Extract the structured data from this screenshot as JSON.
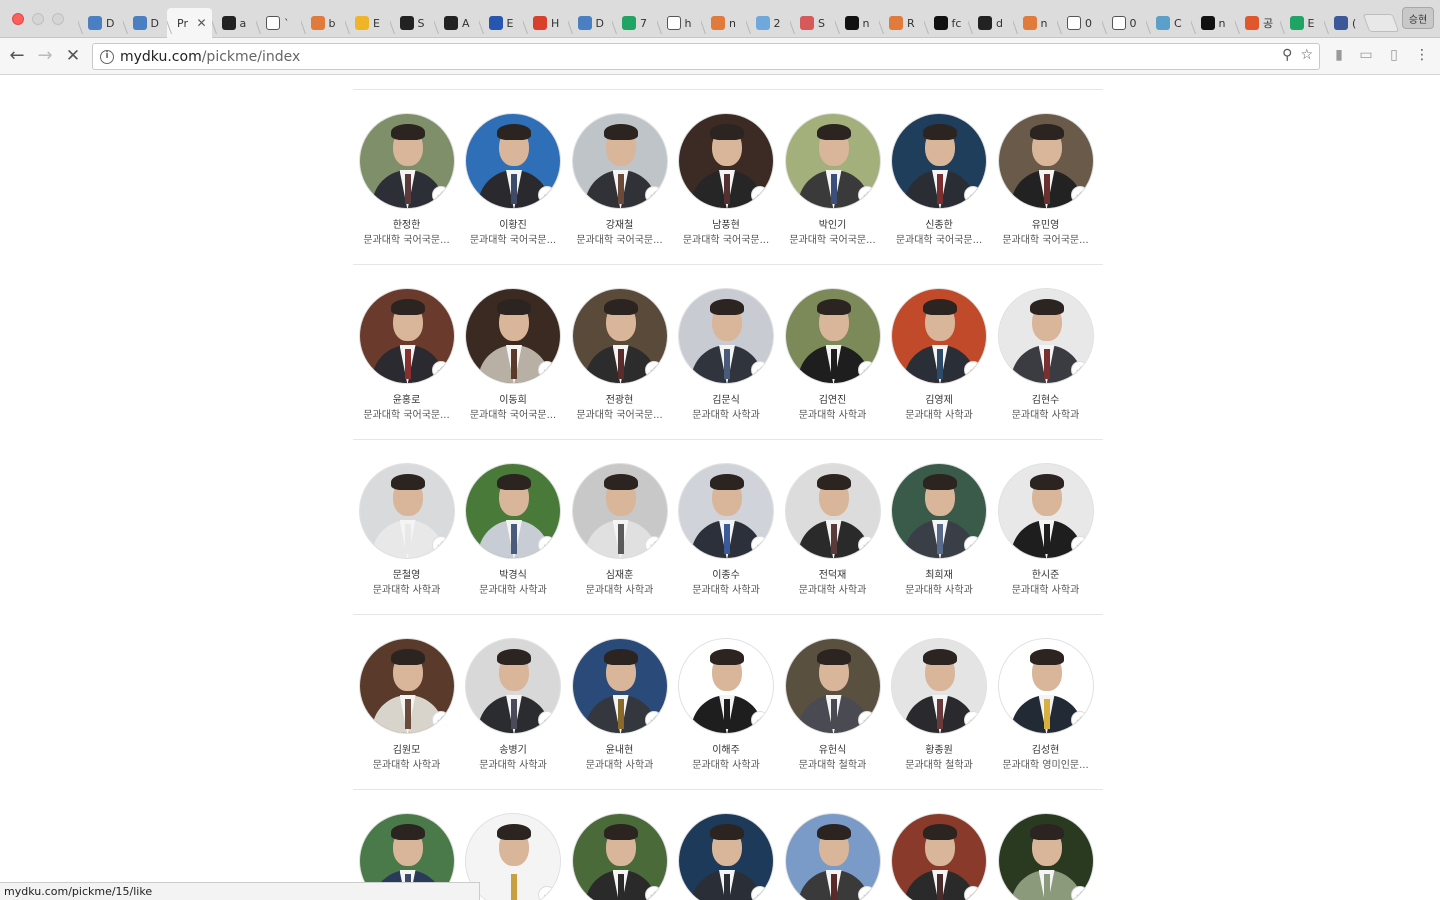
{
  "browser": {
    "tabs": [
      {
        "label": "D",
        "icon": "doc-blue",
        "color": "#4a7fc1"
      },
      {
        "label": "D",
        "icon": "doc-blue",
        "color": "#4a7fc1"
      },
      {
        "label": "Pr",
        "icon": "none",
        "color": "#f6f6f6",
        "active": true
      },
      {
        "label": "a",
        "icon": "github-icon",
        "color": "#222222"
      },
      {
        "label": "`",
        "icon": "page-icon",
        "color": "#ffffff"
      },
      {
        "label": "b",
        "icon": "stack-icon",
        "color": "#e07b3c"
      },
      {
        "label": "E",
        "icon": "box-icon",
        "color": "#f0b429"
      },
      {
        "label": "S",
        "icon": "github-icon",
        "color": "#222222"
      },
      {
        "label": "A",
        "icon": "github-icon",
        "color": "#222222"
      },
      {
        "label": "E",
        "icon": "c-icon",
        "color": "#2656b0"
      },
      {
        "label": "H",
        "icon": "ask-icon",
        "color": "#d9402b"
      },
      {
        "label": "D",
        "icon": "doc-blue",
        "color": "#4a7fc1"
      },
      {
        "label": "7",
        "icon": "drive-icon",
        "color": "#1fa463"
      },
      {
        "label": "h",
        "icon": "page-icon",
        "color": "#ffffff"
      },
      {
        "label": "n",
        "icon": "stack-icon",
        "color": "#e07b3c"
      },
      {
        "label": "2",
        "icon": "star-icon",
        "color": "#6fa8dc"
      },
      {
        "label": "S",
        "icon": "cloud-icon",
        "color": "#d65a5a"
      },
      {
        "label": "n",
        "icon": "k-icon",
        "color": "#111111"
      },
      {
        "label": "R",
        "icon": "stack-icon",
        "color": "#e07b3c"
      },
      {
        "label": "fc",
        "icon": "image-icon",
        "color": "#111111"
      },
      {
        "label": "d",
        "icon": "github-icon",
        "color": "#222222"
      },
      {
        "label": "n",
        "icon": "stack-icon",
        "color": "#e07b3c"
      },
      {
        "label": "0",
        "icon": "google-icon",
        "color": "#ffffff"
      },
      {
        "label": "0",
        "icon": "page-icon",
        "color": "#ffffff"
      },
      {
        "label": "C",
        "icon": "cloud-icon",
        "color": "#5aa0c8"
      },
      {
        "label": "n",
        "icon": "k-icon",
        "color": "#111111"
      },
      {
        "label": "공",
        "icon": "circle-icon",
        "color": "#e0572c"
      },
      {
        "label": "E",
        "icon": "drive-icon",
        "color": "#1fa463"
      },
      {
        "label": "(",
        "icon": "facebook-icon",
        "color": "#3b5998"
      }
    ],
    "profile": "승현",
    "url_host": "mydku.com",
    "url_path": "/pickme/index",
    "status_url": "mydku.com/pickme/15/like"
  },
  "professors": [
    {
      "name": "한정한",
      "dept": "문과대학 국어국문...",
      "bg": "#7e8f6a",
      "suit": "#2c2f36",
      "tie": "#5a3a3a"
    },
    {
      "name": "이황진",
      "dept": "문과대학 국어국문...",
      "bg": "#2f6fb7",
      "suit": "#2a2a2e",
      "tie": "#3d4a6a"
    },
    {
      "name": "강재철",
      "dept": "문과대학 국어국문...",
      "bg": "#bfc4c8",
      "suit": "#303238",
      "tie": "#6b4a3a"
    },
    {
      "name": "남풍현",
      "dept": "문과대학 국어국문...",
      "bg": "#3c2a24",
      "suit": "#262626",
      "tie": "#553030"
    },
    {
      "name": "박인기",
      "dept": "문과대학 국어국문...",
      "bg": "#a4b07c",
      "suit": "#3a3a3a",
      "tie": "#3b4f7a"
    },
    {
      "name": "신종한",
      "dept": "문과대학 국어국문...",
      "bg": "#1f3e5c",
      "suit": "#2a2d33",
      "tie": "#7a2e2e"
    },
    {
      "name": "유민영",
      "dept": "문과대학 국어국문...",
      "bg": "#6a5a4a",
      "suit": "#222222",
      "tie": "#6a2f2f"
    },
    {
      "name": "윤홍로",
      "dept": "문과대학 국어국문...",
      "bg": "#6a3a2c",
      "suit": "#2a2a30",
      "tie": "#8a2f2f"
    },
    {
      "name": "이동희",
      "dept": "문과대학 국어국문...",
      "bg": "#3a2a22",
      "suit": "#b8b0a4",
      "tie": "#5a3a2a"
    },
    {
      "name": "전광현",
      "dept": "문과대학 국어국문...",
      "bg": "#5a4a3a",
      "suit": "#2c2c2c",
      "tie": "#5a2c2c"
    },
    {
      "name": "김문식",
      "dept": "문과대학 사학과",
      "bg": "#c8ccd2",
      "suit": "#30343c",
      "tie": "#4a5a7a"
    },
    {
      "name": "김연진",
      "dept": "문과대학 사학과",
      "bg": "#7c8a5a",
      "suit": "#1e1e1e",
      "tie": "#1e1e1e"
    },
    {
      "name": "김영제",
      "dept": "문과대학 사학과",
      "bg": "#c04a2a",
      "suit": "#2a2e36",
      "tie": "#2e4a6a"
    },
    {
      "name": "김현수",
      "dept": "문과대학 사학과",
      "bg": "#e8e8e8",
      "suit": "#3a3c42",
      "tie": "#7a3030"
    },
    {
      "name": "문철영",
      "dept": "문과대학 사학과",
      "bg": "#d8dadc",
      "suit": "#e8e8e8",
      "tie": "#e8e8e8"
    },
    {
      "name": "박경식",
      "dept": "문과대학 사학과",
      "bg": "#4a7a3a",
      "suit": "#c8ccd4",
      "tie": "#4a5a7a"
    },
    {
      "name": "심재훈",
      "dept": "문과대학 사학과",
      "bg": "#c8c8c8",
      "suit": "#e0e0e0",
      "tie": "#5a5a5a"
    },
    {
      "name": "이종수",
      "dept": "문과대학 사학과",
      "bg": "#d0d4da",
      "suit": "#2c303a",
      "tie": "#3a5a9a"
    },
    {
      "name": "전덕재",
      "dept": "문과대학 사학과",
      "bg": "#dcdcdc",
      "suit": "#2a2a2a",
      "tie": "#5a3a3a"
    },
    {
      "name": "최희재",
      "dept": "문과대학 사학과",
      "bg": "#3a5a4a",
      "suit": "#3a3e46",
      "tie": "#5a6a8a"
    },
    {
      "name": "한시준",
      "dept": "문과대학 사학과",
      "bg": "#e8e8e8",
      "suit": "#1e1e1e",
      "tie": "#1e1e1e"
    },
    {
      "name": "김원모",
      "dept": "문과대학 사학과",
      "bg": "#5a3a2a",
      "suit": "#d8d4cc",
      "tie": "#6a4a3a"
    },
    {
      "name": "송병기",
      "dept": "문과대학 사학과",
      "bg": "#d8d8d8",
      "suit": "#2a2c30",
      "tie": "#4a4a5a"
    },
    {
      "name": "윤내현",
      "dept": "문과대학 사학과",
      "bg": "#2a4a7a",
      "suit": "#34383e",
      "tie": "#8a6a2a"
    },
    {
      "name": "이해주",
      "dept": "문과대학 사학과",
      "bg": "#ffffff",
      "suit": "#1e1e1e",
      "tie": "#1e1e1e"
    },
    {
      "name": "유헌식",
      "dept": "문과대학 철학과",
      "bg": "#5a5040",
      "suit": "#4a4a52",
      "tie": "#4a4a52"
    },
    {
      "name": "황종원",
      "dept": "문과대학 철학과",
      "bg": "#e4e4e4",
      "suit": "#2a2a2e",
      "tie": "#6a3a3a"
    },
    {
      "name": "김성현",
      "dept": "문과대학 영미인문...",
      "bg": "#ffffff",
      "suit": "#222a36",
      "tie": "#d8b040"
    },
    {
      "name": "",
      "dept": "",
      "bg": "#4a7a4a",
      "suit": "#2a3a5a",
      "tie": "#3a4a6a"
    },
    {
      "name": "",
      "dept": "",
      "bg": "#f4f4f4",
      "suit": "#f4f4f4",
      "tie": "#c8a040"
    },
    {
      "name": "",
      "dept": "",
      "bg": "#4a6a3a",
      "suit": "#2a2a2a",
      "tie": "#2a2a2a"
    },
    {
      "name": "",
      "dept": "",
      "bg": "#1e3a5a",
      "suit": "#2a2e36",
      "tie": "#2a2e36"
    },
    {
      "name": "",
      "dept": "",
      "bg": "#7a9ac8",
      "suit": "#3a3a3a",
      "tie": "#5a2a2a"
    },
    {
      "name": "",
      "dept": "",
      "bg": "#8a3a2a",
      "suit": "#2a2a2a",
      "tie": "#4a2a2a"
    },
    {
      "name": "",
      "dept": "",
      "bg": "#2a3a20",
      "suit": "#8a9a7a",
      "tie": "#8a9a7a"
    }
  ]
}
